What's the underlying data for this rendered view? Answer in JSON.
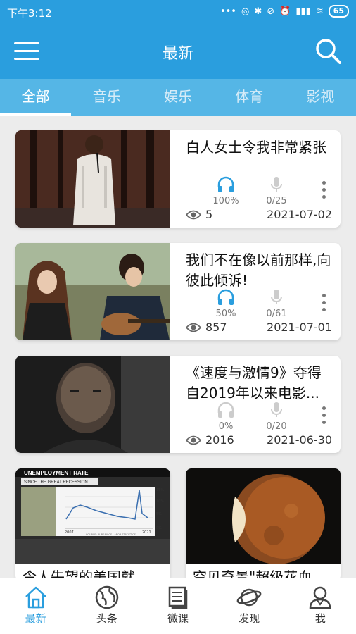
{
  "status": {
    "time": "下午3:12",
    "battery": "65",
    "network": "4G"
  },
  "appbar": {
    "title": "最新"
  },
  "tabs": [
    {
      "label": "全部",
      "active": true
    },
    {
      "label": "音乐",
      "active": false
    },
    {
      "label": "娱乐",
      "active": false
    },
    {
      "label": "体育",
      "active": false
    },
    {
      "label": "影视",
      "active": false
    }
  ],
  "cards": [
    {
      "title": "白人女士令我非常紧张",
      "listen": "100%",
      "record": "0/25",
      "views": "5",
      "date": "2021-07-02"
    },
    {
      "title": "我们不在像以前那样,向彼此倾诉!",
      "listen": "50%",
      "record": "0/61",
      "views": "857",
      "date": "2021-07-01"
    },
    {
      "title": "《速度与激情9》夺得自2019年以来电影...",
      "listen": "0%",
      "record": "0/20",
      "views": "2016",
      "date": "2021-06-30"
    }
  ],
  "grid": [
    {
      "title": "令人失望的美国就",
      "chart": {
        "title": "UNEMPLOYMENT RATE",
        "subtitle": "SINCE THE GREAT RECESSION",
        "ticks": [
          "15%",
          "10%",
          "5%",
          "0%"
        ],
        "years": [
          "2007",
          "2021"
        ],
        "source": "SOURCE: BUREAU OF LABOR STATISTICS"
      }
    },
    {
      "title": "空见奇景\"超级花血"
    }
  ],
  "nav": [
    {
      "label": "最新",
      "icon": "home-icon",
      "active": true
    },
    {
      "label": "头条",
      "icon": "globe-icon",
      "active": false
    },
    {
      "label": "微课",
      "icon": "book-icon",
      "active": false
    },
    {
      "label": "发现",
      "icon": "planet-icon",
      "active": false
    },
    {
      "label": "我",
      "icon": "profile-icon",
      "active": false
    }
  ],
  "colors": {
    "primary": "#2a9ede",
    "tabbar": "#55b6e6",
    "active_listen": "#2a9ede",
    "inactive": "#bbbbbb"
  }
}
